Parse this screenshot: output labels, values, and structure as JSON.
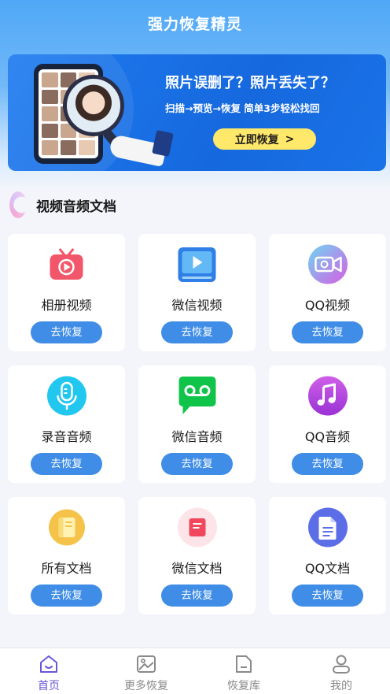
{
  "app": {
    "title": "强力恢复精灵"
  },
  "banner": {
    "headline": "照片误删了？照片丢失了？",
    "subline": "扫描→预览→恢复  简单3步轻松找回",
    "cta_label": "立即恢复",
    "cta_arrow": ">"
  },
  "section": {
    "title": "视频音频文档"
  },
  "cards": [
    {
      "label": "相册视频",
      "button": "去恢复",
      "icon": "tv-play-icon",
      "color": "#f2566a"
    },
    {
      "label": "微信视频",
      "button": "去恢复",
      "icon": "video-player-icon",
      "color": "#2f7fe6"
    },
    {
      "label": "QQ视频",
      "button": "去恢复",
      "icon": "camera-video-icon",
      "color": "#c56be8"
    },
    {
      "label": "录音音频",
      "button": "去恢复",
      "icon": "microphone-icon",
      "color": "#22c7ef"
    },
    {
      "label": "微信音频",
      "button": "去恢复",
      "icon": "voicemail-icon",
      "color": "#10c44a"
    },
    {
      "label": "QQ音频",
      "button": "去恢复",
      "icon": "music-note-icon",
      "color": "#b94be3"
    },
    {
      "label": "所有文档",
      "button": "去恢复",
      "icon": "notebook-icon",
      "color": "#f6c34a"
    },
    {
      "label": "微信文档",
      "button": "去恢复",
      "icon": "document-icon",
      "color": "#f0475d"
    },
    {
      "label": "QQ文档",
      "button": "去恢复",
      "icon": "file-icon",
      "color": "#5b6ee8"
    }
  ],
  "tabs": [
    {
      "label": "首页",
      "icon": "home-icon",
      "active": true
    },
    {
      "label": "更多恢复",
      "icon": "image-icon",
      "active": false
    },
    {
      "label": "恢复库",
      "icon": "folder-icon",
      "active": false
    },
    {
      "label": "我的",
      "icon": "user-icon",
      "active": false
    }
  ],
  "colors": {
    "accent": "#3f8de6",
    "active_tab": "#6c55d9",
    "cta": "#ffe86a"
  }
}
